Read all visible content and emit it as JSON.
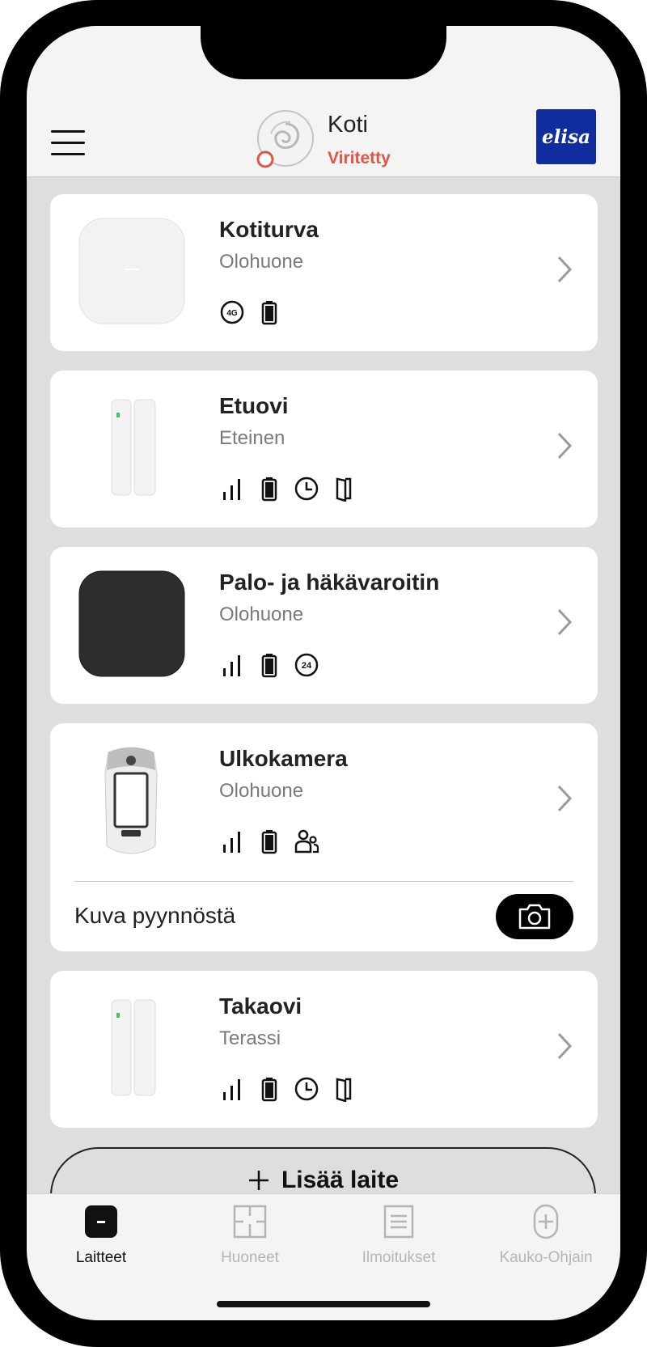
{
  "header": {
    "hub_name": "Koti",
    "hub_status": "Viritetty",
    "status_color": "#e05545",
    "brand": "elisa",
    "brand_color": "#0f2d9e"
  },
  "devices": [
    {
      "name": "Kotiturva",
      "room": "Olohuone",
      "icons": [
        "4g-icon",
        "battery-icon"
      ]
    },
    {
      "name": "Etuovi",
      "room": "Eteinen",
      "icons": [
        "signal-icon",
        "battery-icon",
        "clock-icon",
        "door-icon"
      ]
    },
    {
      "name": "Palo- ja häkävaroitin",
      "room": "Olohuone",
      "icons": [
        "signal-icon",
        "battery-icon",
        "24h-icon"
      ],
      "badge_24": "24"
    },
    {
      "name": "Ulkokamera",
      "room": "Olohuone",
      "icons": [
        "signal-icon",
        "battery-icon",
        "people-icon"
      ],
      "snapshot_label": "Kuva pyynnöstä"
    },
    {
      "name": "Takaovi",
      "room": "Terassi",
      "icons": [
        "signal-icon",
        "battery-icon",
        "clock-icon",
        "door-icon"
      ]
    }
  ],
  "add_device": {
    "label": "Lisää laite"
  },
  "nav": {
    "items": [
      {
        "label": "Laitteet",
        "active": true
      },
      {
        "label": "Huoneet",
        "active": false
      },
      {
        "label": "Ilmoitukset",
        "active": false
      },
      {
        "label": "Kauko-Ohjain",
        "active": false
      }
    ],
    "active_color": "#111111",
    "inactive_color": "#b5b5b5"
  }
}
